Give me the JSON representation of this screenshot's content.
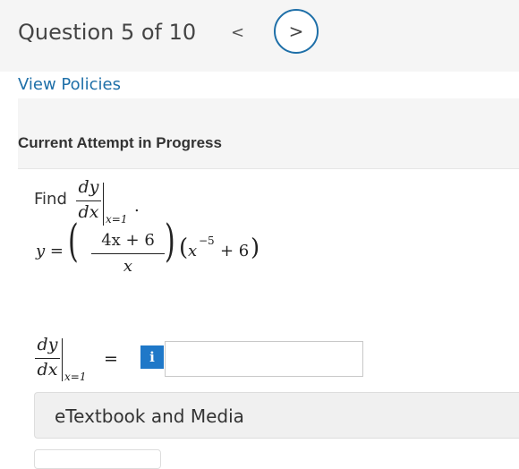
{
  "header": {
    "question_label": "Question 5 of 10",
    "prev_glyph": "<",
    "next_glyph": ">"
  },
  "links": {
    "view_policies": "View Policies"
  },
  "attempt": {
    "heading": "Current Attempt in Progress"
  },
  "problem": {
    "find_label": "Find",
    "dy": "dy",
    "dx": "dx",
    "eval_at": "x=1",
    "period": ".",
    "y_eq": "y =",
    "numerator": "4x + 6",
    "denominator": "x",
    "second_factor_base": "x",
    "second_factor_exp": "−5",
    "second_factor_add": "+ 6",
    "answer_equals": "="
  },
  "answer": {
    "info_label": "i",
    "value": ""
  },
  "resources": {
    "etextbook_label": "eTextbook and Media"
  },
  "colors": {
    "link": "#1e6fa8",
    "info_button": "#1f78c8"
  }
}
